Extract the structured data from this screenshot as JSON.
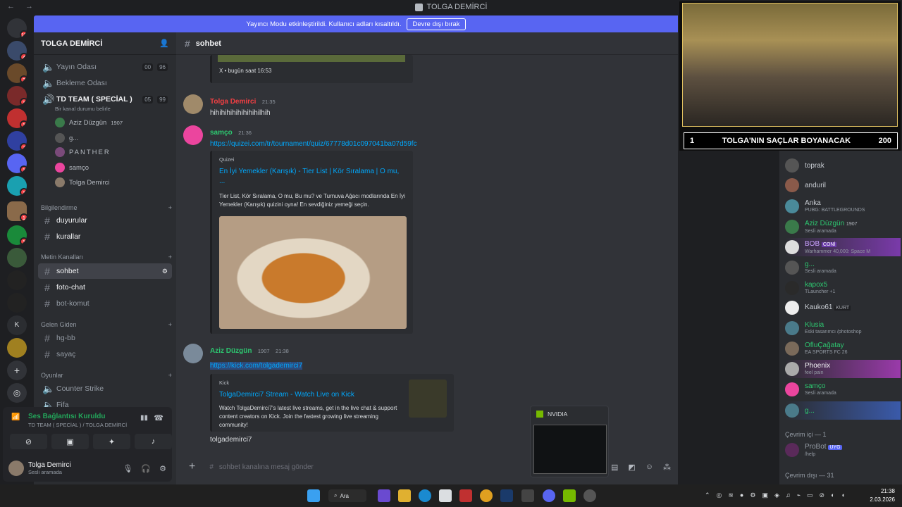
{
  "window": {
    "title": "TOLGA DEMİRCİ",
    "nav": "← →"
  },
  "banner": {
    "text": "Yayıncı Modu etkinleştirildi. Kullanıcı adları kısaltıldı.",
    "button": "Devre dışı bırak"
  },
  "guild_badges": [
    "13",
    "4",
    "2",
    "1",
    "1",
    "2",
    "1",
    "1",
    "1",
    "1"
  ],
  "guild_k_label": "K",
  "server": {
    "name": "TOLGA DEMİRCİ"
  },
  "channels": {
    "cat_voice": "Yayın Odası",
    "voice1": {
      "name": "Yayın Odası",
      "c1": "00",
      "c2": "96"
    },
    "voice2": {
      "name": "Bekleme Odası"
    },
    "voice3": {
      "name": "TD TEAM ( SPECİAL )",
      "status": "Bir kanal durumu belirle",
      "c1": "05",
      "c2": "99"
    },
    "voice_users": [
      "Aziz Düzgün",
      "g...",
      "PANTHER",
      "samço",
      "Tolga Demirci"
    ],
    "aziz_badge": "1907",
    "cat_info": "Bilgilendirme",
    "info": [
      "duyurular",
      "kurallar"
    ],
    "cat_text": "Metin Kanalları",
    "text": [
      "sohbet",
      "foto-chat",
      "bot-komut"
    ],
    "cat_welcome": "Gelen Giden",
    "welcome": [
      "hg-bb",
      "sayaç"
    ],
    "cat_games": "Oyunlar",
    "games": [
      "Counter Strike",
      "Fifa"
    ]
  },
  "voice_panel": {
    "status": "Ses Bağlantısı Kuruldu",
    "sub": "TD TEAM ( SPECİAL ) / TOLGA DEMİRCİ"
  },
  "user": {
    "name": "Tolga Demirci",
    "status": "Sesli aramada"
  },
  "chat": {
    "channel": "sohbet",
    "x_embed_time": "bugün saat 16:53",
    "x_label": "X",
    "messages": [
      {
        "author": "Tolga Demirci",
        "time": "21:35",
        "text": "hihihihihihihihihilhih",
        "color": "#f23f43"
      },
      {
        "author": "samço",
        "time": "21:36",
        "link": "https://quizei.com/tr/tournament/quiz/67778d01c097041ba07d59fc",
        "color": "#2dc770",
        "embed": {
          "provider": "Quizei",
          "title": "En İyi Yemekler (Karışık) - Tier List | Kör Sıralama | O mu, ...",
          "desc": "Tier List, Kör Sıralama, O mu, Bu mu? ve Turnuva Ağacı modlarında En İyi Yemekler (Karışık) quizini oyna! En sevdiğiniz yemeği seçin."
        }
      },
      {
        "author": "Aziz Düzgün",
        "badge": "1907",
        "time": "21:38",
        "link": "https://kick.com/tolgademirci7",
        "color": "#2dc770",
        "embed": {
          "provider": "Kick",
          "title": "TolgaDemirci7 Stream - Watch Live on Kick",
          "desc": "Watch TolgaDemirci7's latest live streams, get in the live chat & support content creators on Kick. Join the fastest growing live streaming community!"
        },
        "after": "tolgademirci7"
      }
    ],
    "placeholder": "sohbet kanalına mesaj gönder"
  },
  "stream": {
    "rank": "1",
    "title": "TOLGA'NIN SAÇLAR BOYANACAK",
    "score": "200"
  },
  "members": {
    "list": [
      {
        "name": "toprak",
        "act": ""
      },
      {
        "name": "anduril",
        "act": ""
      },
      {
        "name": "Anka",
        "act": "PUBG: BATTLEGROUNDS"
      },
      {
        "name": "Aziz Düzgün",
        "badge": "1907",
        "act": "Sesli aramada"
      },
      {
        "name": "BOB",
        "badge": "CONİ",
        "act": "Warhammer 40,000: Space M"
      },
      {
        "name": "g...",
        "act": "Sesli aramada"
      },
      {
        "name": "kapox5",
        "act": "TLauncher +1"
      },
      {
        "name": "Kauko61",
        "badge": "KURT",
        "act": ""
      },
      {
        "name": "Klusia",
        "act": "Eski tasarımcı /photoshop"
      },
      {
        "name": "OfluÇağatay",
        "act": "EA SPORTS FC 26"
      },
      {
        "name": "Phoenix",
        "act": "feel pain"
      },
      {
        "name": "samço",
        "act": "Sesli aramada"
      },
      {
        "name": "g...",
        "act": ""
      }
    ],
    "online_cat": "Çevrim içi — 1",
    "bot": {
      "name": "ProBot",
      "badge": "UYG",
      "act": "/help"
    },
    "offline_cat": "Çevrim dışı — 31"
  },
  "nvidia": {
    "title": "NVIDIA"
  },
  "taskbar": {
    "search": "Ara",
    "time": "21:38",
    "date": "2.03.2026"
  }
}
